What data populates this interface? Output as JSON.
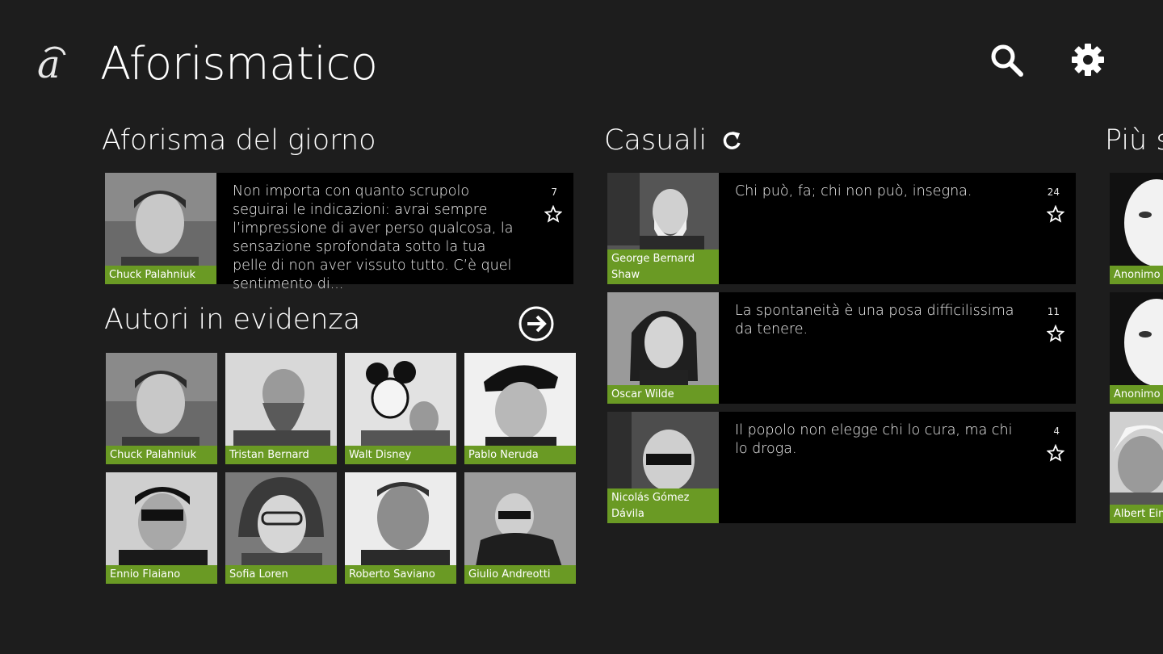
{
  "app": {
    "title": "Aforismatico",
    "logo_glyph": "a"
  },
  "toolbar": {
    "search_icon": "search-icon",
    "settings_icon": "gear-icon"
  },
  "sections": {
    "day": "Aforisma del giorno",
    "random": "Casuali",
    "popular": "Più s",
    "authors": "Autori in evidenza"
  },
  "day_quote": {
    "author": "Chuck Palahniuk",
    "text": "Non importa con quanto scrupolo seguirai le indicazioni: avrai sempre l’impressione di aver perso qualcosa, la sensazione sprofondata sotto la tua pelle di non aver vissuto tutto. C’è quel sentimento di...",
    "count": "7"
  },
  "random_quotes": [
    {
      "author": "George Bernard Shaw",
      "text": "Chi può, fa; chi non può, insegna.",
      "count": "24"
    },
    {
      "author": "Oscar Wilde",
      "text": "La spontaneità è una posa difficilissima da tenere.",
      "count": "11"
    },
    {
      "author": "Nicolás Gómez Dávila",
      "text": "Il popolo non elegge chi lo cura, ma chi lo droga.",
      "count": "4"
    }
  ],
  "authors": [
    {
      "name": "Chuck Palahniuk"
    },
    {
      "name": "Tristan Bernard"
    },
    {
      "name": "Walt Disney"
    },
    {
      "name": "Pablo Neruda"
    },
    {
      "name": "Ennio Flaiano"
    },
    {
      "name": "Sofia Loren"
    },
    {
      "name": "Roberto Saviano"
    },
    {
      "name": "Giulio Andreotti"
    }
  ],
  "popular": [
    {
      "author": "Anonimo"
    },
    {
      "author": "Anonimo"
    },
    {
      "author": "Albert Ein"
    }
  ],
  "colors": {
    "background": "#1d1d1d",
    "accent": "#6a9a24",
    "card": "#000000"
  }
}
